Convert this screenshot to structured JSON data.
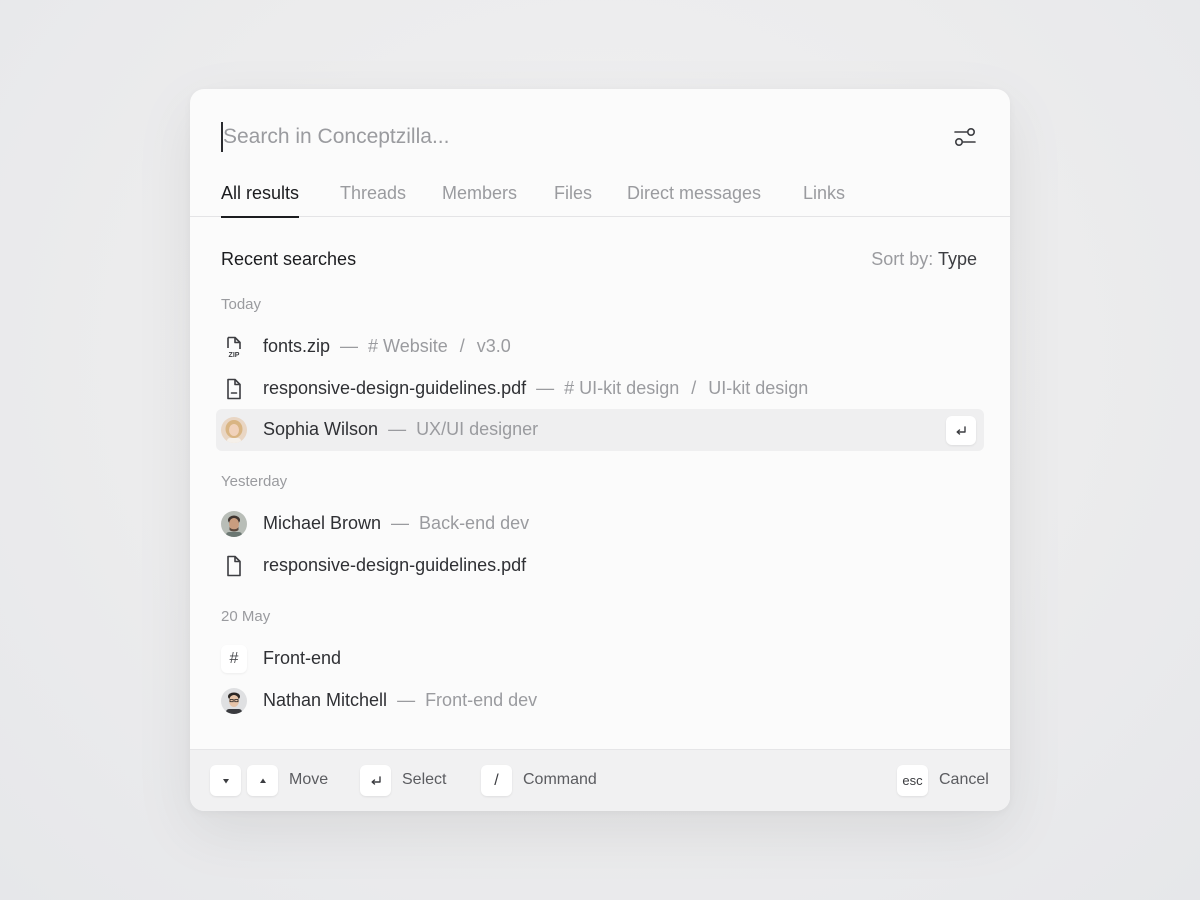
{
  "search": {
    "placeholder": "Search in Conceptzilla..."
  },
  "tabs": [
    {
      "label": "All results",
      "active": true
    },
    {
      "label": "Threads",
      "active": false
    },
    {
      "label": "Members",
      "active": false
    },
    {
      "label": "Files",
      "active": false
    },
    {
      "label": "Direct messages",
      "active": false
    },
    {
      "label": "Links",
      "active": false
    }
  ],
  "recent": {
    "title": "Recent searches",
    "sort_label": "Sort by:",
    "sort_value": "Type"
  },
  "groups": [
    {
      "label": "Today",
      "items": [
        {
          "icon": "zip-file-icon",
          "name": "fonts.zip",
          "channel": "# Website",
          "path": "v3.0"
        },
        {
          "icon": "pdf-file-icon",
          "name": "responsive-design-guidelines.pdf",
          "channel": "# UI-kit design",
          "path": "UI-kit design"
        },
        {
          "icon": "avatar",
          "name": "Sophia Wilson",
          "role": "UX/UI designer",
          "selected": true
        }
      ]
    },
    {
      "label": "Yesterday",
      "items": [
        {
          "icon": "avatar",
          "name": "Michael Brown",
          "role": "Back-end dev"
        },
        {
          "icon": "file-icon",
          "name": "responsive-design-guidelines.pdf"
        }
      ]
    },
    {
      "label": "20 May",
      "items": [
        {
          "icon": "hash-icon",
          "name": "Front-end"
        },
        {
          "icon": "avatar",
          "name": "Nathan Mitchell",
          "role": "Front-end dev"
        }
      ]
    }
  ],
  "separator": "—",
  "slash": "/",
  "hash_symbol": "#",
  "footer": {
    "move_label": "Move",
    "select_label": "Select",
    "command_key": "/",
    "command_label": "Command",
    "esc_key": "esc",
    "cancel_label": "Cancel"
  },
  "colors": {
    "accent": "#1b1c1f",
    "muted": "#9a9b9f",
    "selected_row": "#efeff0"
  }
}
